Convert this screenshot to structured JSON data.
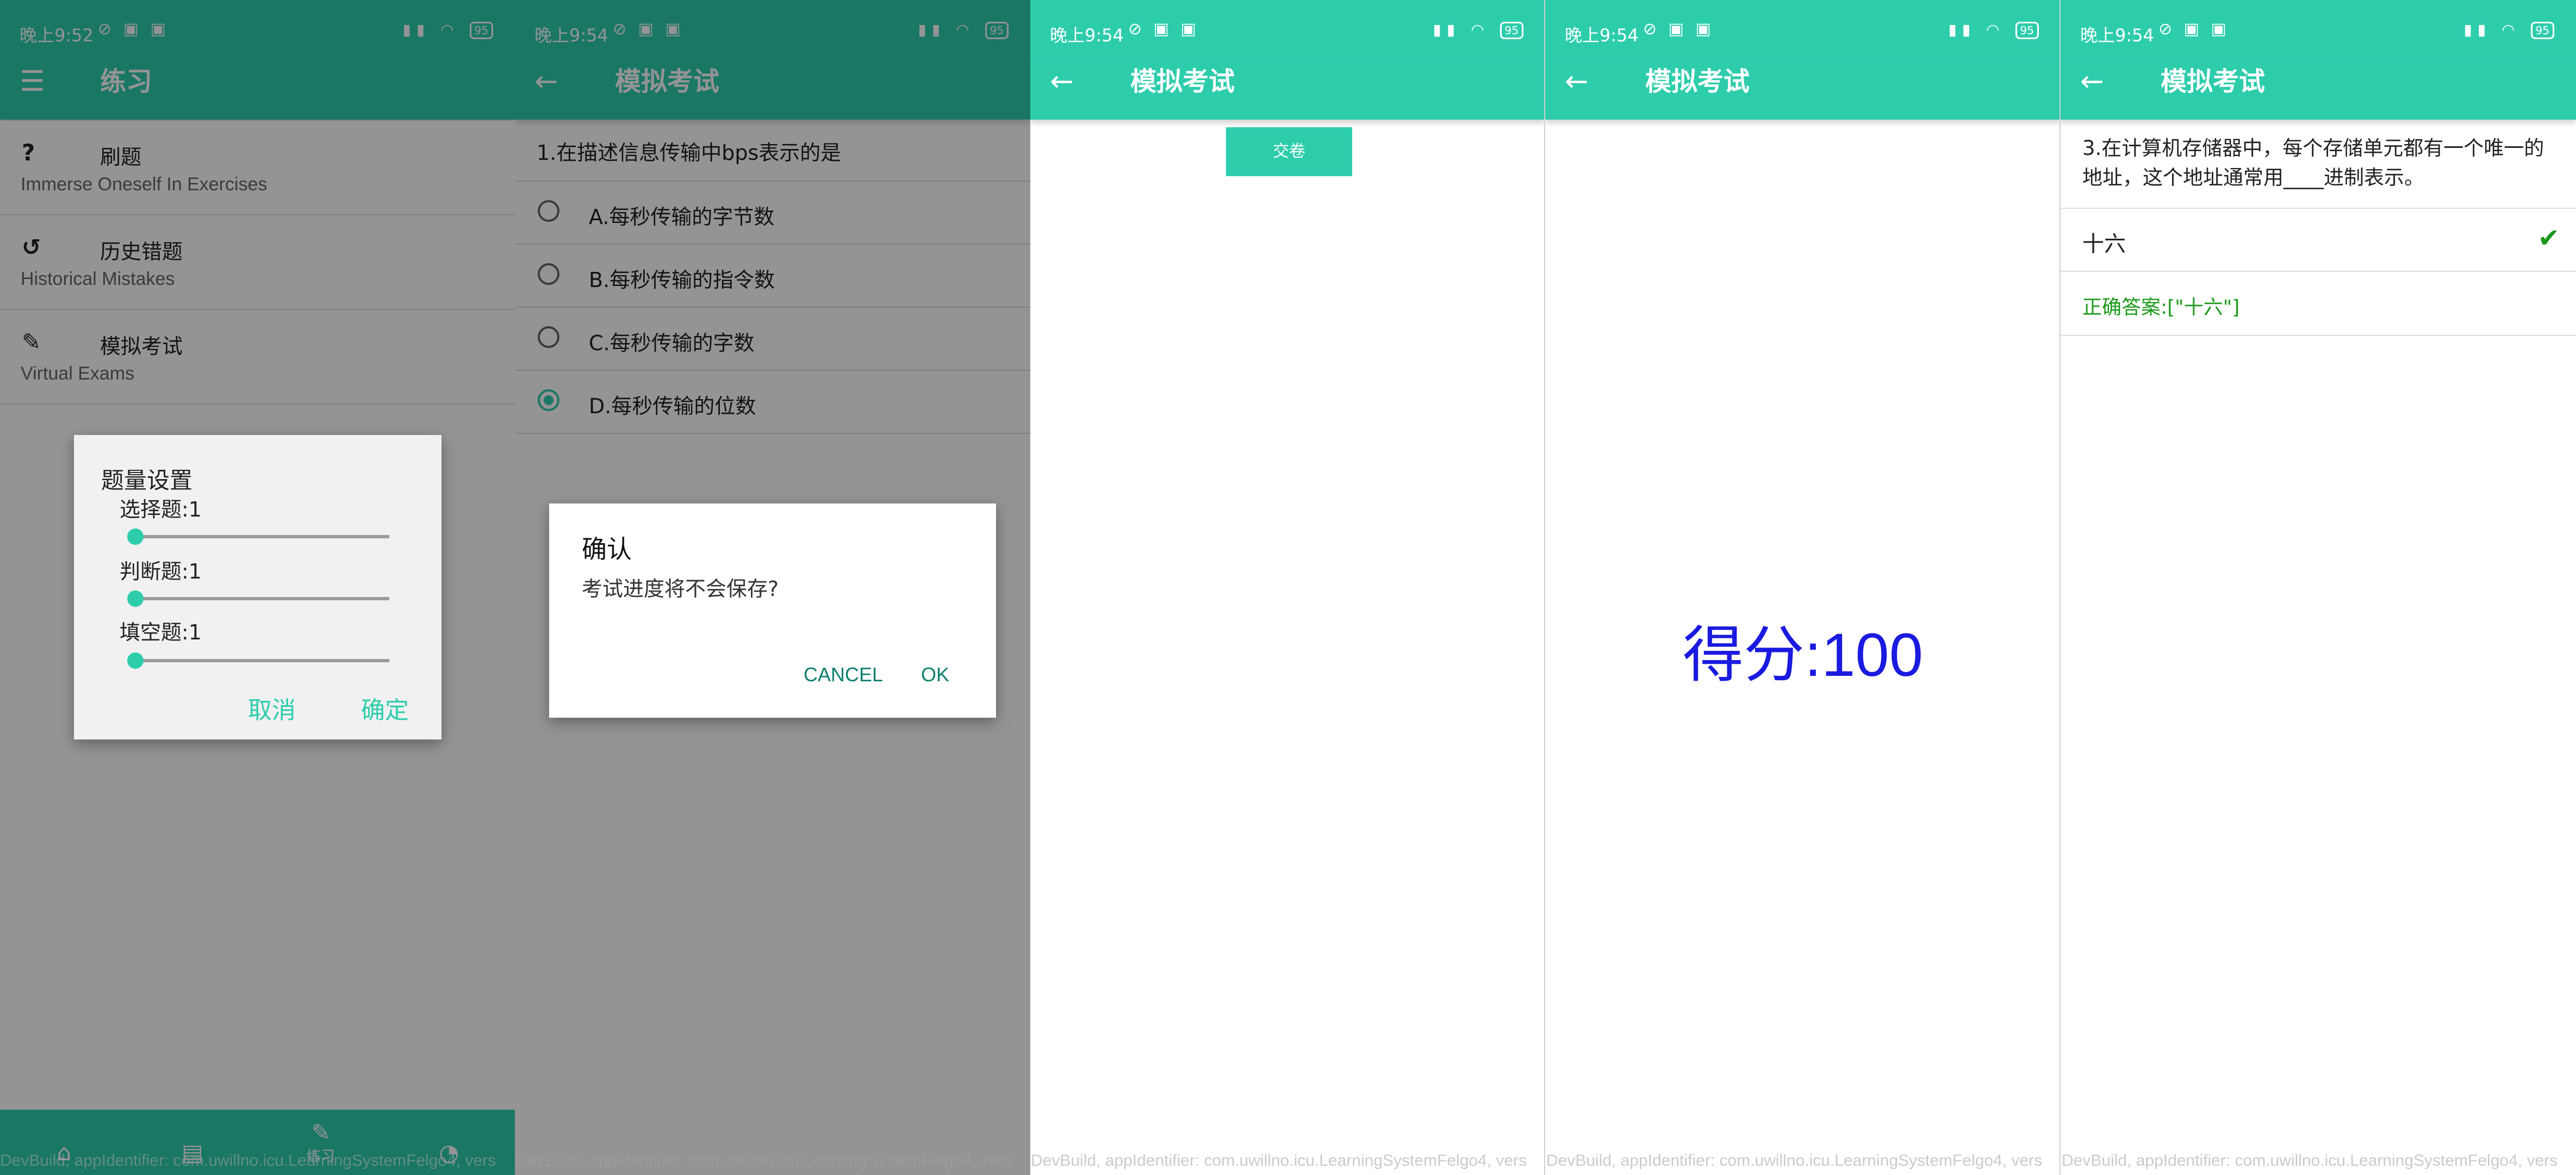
{
  "status": {
    "time_p1": "晚上9:52",
    "time_other": "晚上9:54",
    "battery": "95"
  },
  "panel1": {
    "title": "练习",
    "items": [
      {
        "icon": "?",
        "title": "刷题",
        "subtitle": "Immerse Oneself In Exercises"
      },
      {
        "icon": "↺",
        "title": "历史错题",
        "subtitle": "Historical Mistakes"
      },
      {
        "icon": "✎",
        "title": "模拟考试",
        "subtitle": "Virtual Exams"
      }
    ],
    "dialog": {
      "title": "题量设置",
      "sliders": [
        {
          "label": "选择题:1",
          "value": 1
        },
        {
          "label": "判断题:1",
          "value": 1
        },
        {
          "label": "填空题:1",
          "value": 1
        }
      ],
      "cancel": "取消",
      "confirm": "确定"
    },
    "bottom_nav": {
      "practice_label": "练习"
    }
  },
  "panel2": {
    "title": "模拟考试",
    "question": "1.在描述信息传输中bps表示的是",
    "options": [
      {
        "label": "A.每秒传输的字节数",
        "checked": false
      },
      {
        "label": "B.每秒传输的指令数",
        "checked": false
      },
      {
        "label": "C.每秒传输的字数",
        "checked": false
      },
      {
        "label": "D.每秒传输的位数",
        "checked": true
      }
    ],
    "dialog": {
      "title": "确认",
      "message": "考试进度将不会保存?",
      "cancel": "CANCEL",
      "ok": "OK"
    }
  },
  "panel3": {
    "title": "模拟考试",
    "submit": "交卷"
  },
  "panel4": {
    "title": "模拟考试",
    "score": "得分:100"
  },
  "panel5": {
    "title": "模拟考试",
    "question": "3.在计算机存储器中，每个存储单元都有一个唯一的地址，这个地址通常用____进制表示。",
    "answer": "十六",
    "correct_answer": "正确答案:[\"十六\"]"
  },
  "watermark": "DevBuild, appIdentifier: com.uwillno.icu.LearningSystemFelgo4, vers",
  "colors": {
    "primary": "#2dcdac",
    "score": "#1a1ae0",
    "correct": "#1a9a1a"
  }
}
